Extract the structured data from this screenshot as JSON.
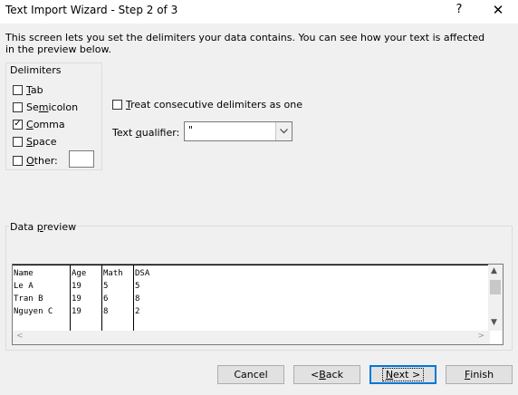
{
  "dialog": {
    "title": "Text Import Wizard - Step 2 of 3",
    "help_glyph": "?",
    "close_glyph": "✕",
    "description": "This screen lets you set the delimiters your data contains.  You can see how your text is affected in the preview below."
  },
  "delimiters": {
    "legend": "Delimiters",
    "options": [
      {
        "label": "Tab",
        "checked": false,
        "accel": "T"
      },
      {
        "label": "Semicolon",
        "checked": false,
        "accel": "m"
      },
      {
        "label": "Comma",
        "checked": true,
        "accel": "C"
      },
      {
        "label": "Space",
        "checked": false,
        "accel": "S"
      },
      {
        "label": "Other:",
        "checked": false,
        "accel": "O"
      }
    ],
    "other_value": ""
  },
  "treat_consecutive": {
    "label": "Treat consecutive delimiters as one",
    "checked": false
  },
  "text_qualifier": {
    "label": "Text qualifier:",
    "value": "\""
  },
  "preview": {
    "label": "Data preview",
    "columns": [
      [
        "Name",
        "Le A",
        "Tran B",
        "Nguyen C"
      ],
      [
        "Age",
        "19",
        "19",
        "19"
      ],
      [
        "Math",
        "5",
        "6",
        "8"
      ],
      [
        "DSA",
        "5",
        "8",
        "2"
      ]
    ]
  },
  "buttons": {
    "cancel": "Cancel",
    "back": "< Back",
    "next": "Next >",
    "finish": "Finish"
  },
  "icons": {
    "checkmark": "✓",
    "dropdown": "chevron-down-icon",
    "scroll_up": "▲",
    "scroll_down": "▼",
    "scroll_left": "<",
    "scroll_right": ">"
  }
}
